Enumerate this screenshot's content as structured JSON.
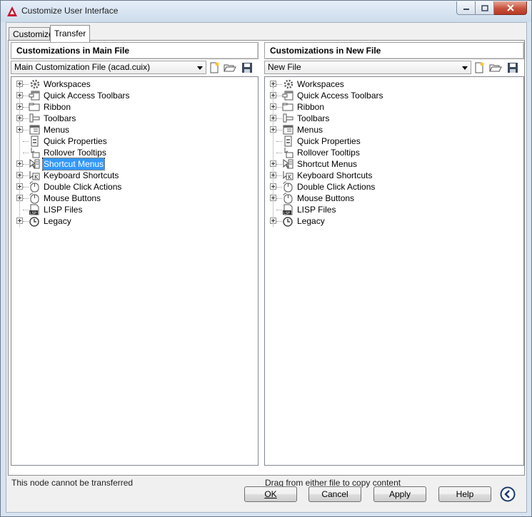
{
  "window": {
    "title": "Customize User Interface",
    "accent_color": "#c8102e"
  },
  "tabs": [
    {
      "label": "Customize",
      "active": false
    },
    {
      "label": "Transfer",
      "active": true
    }
  ],
  "left_pane": {
    "header": "Customizations in Main File",
    "file_select": "Main Customization File (acad.cuix)",
    "status": "This node cannot be transferred",
    "selected_item": "Shortcut Menus"
  },
  "right_pane": {
    "header": "Customizations in New File",
    "file_select": "New File",
    "status": "Drag from either file to copy content"
  },
  "tree_items": [
    {
      "label": "Workspaces",
      "icon": "workspaces-icon",
      "expandable": true
    },
    {
      "label": "Quick Access Toolbars",
      "icon": "quick-access-toolbars-icon",
      "expandable": true
    },
    {
      "label": "Ribbon",
      "icon": "ribbon-icon",
      "expandable": true
    },
    {
      "label": "Toolbars",
      "icon": "toolbars-icon",
      "expandable": true
    },
    {
      "label": "Menus",
      "icon": "menus-icon",
      "expandable": true
    },
    {
      "label": "Quick Properties",
      "icon": "quick-properties-icon",
      "expandable": false
    },
    {
      "label": "Rollover Tooltips",
      "icon": "rollover-tooltips-icon",
      "expandable": false
    },
    {
      "label": "Shortcut Menus",
      "icon": "shortcut-menus-icon",
      "expandable": true
    },
    {
      "label": "Keyboard Shortcuts",
      "icon": "keyboard-shortcuts-icon",
      "expandable": true
    },
    {
      "label": "Double Click Actions",
      "icon": "double-click-actions-icon",
      "expandable": true
    },
    {
      "label": "Mouse Buttons",
      "icon": "mouse-buttons-icon",
      "expandable": true
    },
    {
      "label": "LISP Files",
      "icon": "lisp-files-icon",
      "expandable": false
    },
    {
      "label": "Legacy",
      "icon": "legacy-icon",
      "expandable": true
    }
  ],
  "buttons": {
    "ok": "OK",
    "cancel": "Cancel",
    "apply": "Apply",
    "help": "Help"
  }
}
